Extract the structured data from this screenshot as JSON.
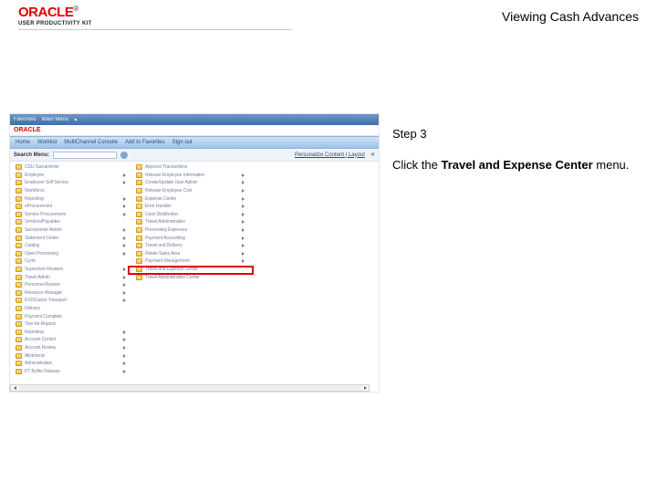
{
  "header": {
    "logo_text": "ORACLE",
    "logo_tm": "®",
    "logo_sub": "USER PRODUCTIVITY KIT",
    "page_title": "Viewing Cash Advances"
  },
  "instruction": {
    "step_label": "Step 3",
    "body_prefix": "Click the ",
    "body_bold": "Travel and Expense Center",
    "body_suffix": " menu."
  },
  "screenshot": {
    "topbar": {
      "items": [
        "Favorites",
        "Main Menu"
      ],
      "caret": "▾"
    },
    "inner_logo": "ORACLE",
    "tabs": [
      "Home",
      "Worklist",
      "MultiChannel Console",
      "Add to Favorites",
      "Sign out"
    ],
    "search": {
      "label": "Search Menu:",
      "right_link": "Personalize Content | Layout",
      "right_x": "✕"
    },
    "highlight_target_index": 14,
    "left_items": [
      {
        "label": "CSU Sacramento",
        "arrow": false
      },
      {
        "label": "Employee",
        "arrow": true
      },
      {
        "label": "Employee Self Service",
        "arrow": true
      },
      {
        "label": "Workforce",
        "arrow": false
      },
      {
        "label": "Reporting",
        "arrow": true
      },
      {
        "label": "eProcurement",
        "arrow": true
      },
      {
        "label": "Service Procurement",
        "arrow": true
      },
      {
        "label": "Vendors/Payables",
        "arrow": false
      },
      {
        "label": "Sacramento Admin",
        "arrow": true
      },
      {
        "label": "Statement Center",
        "arrow": true
      },
      {
        "label": "Catalog",
        "arrow": true
      },
      {
        "label": "Open Processing",
        "arrow": true
      },
      {
        "label": "Cycle",
        "arrow": false
      },
      {
        "label": "Supervisor Reviews",
        "arrow": true
      },
      {
        "label": "Travel Admin",
        "arrow": true
      },
      {
        "label": "Personnel Review",
        "arrow": true
      },
      {
        "label": "Resource Manager",
        "arrow": true
      },
      {
        "label": "EVOCache Transport",
        "arrow": true
      },
      {
        "label": "Delivery",
        "arrow": false
      },
      {
        "label": "Payment Complete",
        "arrow": false
      },
      {
        "label": "Tree for Reports",
        "arrow": false
      },
      {
        "label": "Reporting",
        "arrow": true
      },
      {
        "label": "Account Control",
        "arrow": true
      },
      {
        "label": "Account Review",
        "arrow": true
      },
      {
        "label": "Allotments",
        "arrow": true
      },
      {
        "label": "Administration",
        "arrow": true
      },
      {
        "label": "PT Buffer Release",
        "arrow": true
      }
    ],
    "right_items": [
      {
        "label": "Approve Transactions",
        "arrow": false
      },
      {
        "label": "Release Employee Information",
        "arrow": true
      },
      {
        "label": "Create/Update User Admin",
        "arrow": true
      },
      {
        "label": "Release Employee Cost",
        "arrow": true
      },
      {
        "label": "Expense Center",
        "arrow": true
      },
      {
        "label": "Error Handler",
        "arrow": true
      },
      {
        "label": "Cash Distribution",
        "arrow": true
      },
      {
        "label": "Travel Administration",
        "arrow": true
      },
      {
        "label": "Processing Expenses",
        "arrow": true
      },
      {
        "label": "Payment Accounting",
        "arrow": true
      },
      {
        "label": "Travel and Delivery",
        "arrow": true
      },
      {
        "label": "Relate Sales Area",
        "arrow": true
      },
      {
        "label": "Payment Management",
        "arrow": true
      },
      {
        "label": "Travel and Expense Center",
        "arrow": false,
        "highlight": true
      },
      {
        "label": "Travel Administration Center",
        "arrow": false
      }
    ]
  }
}
